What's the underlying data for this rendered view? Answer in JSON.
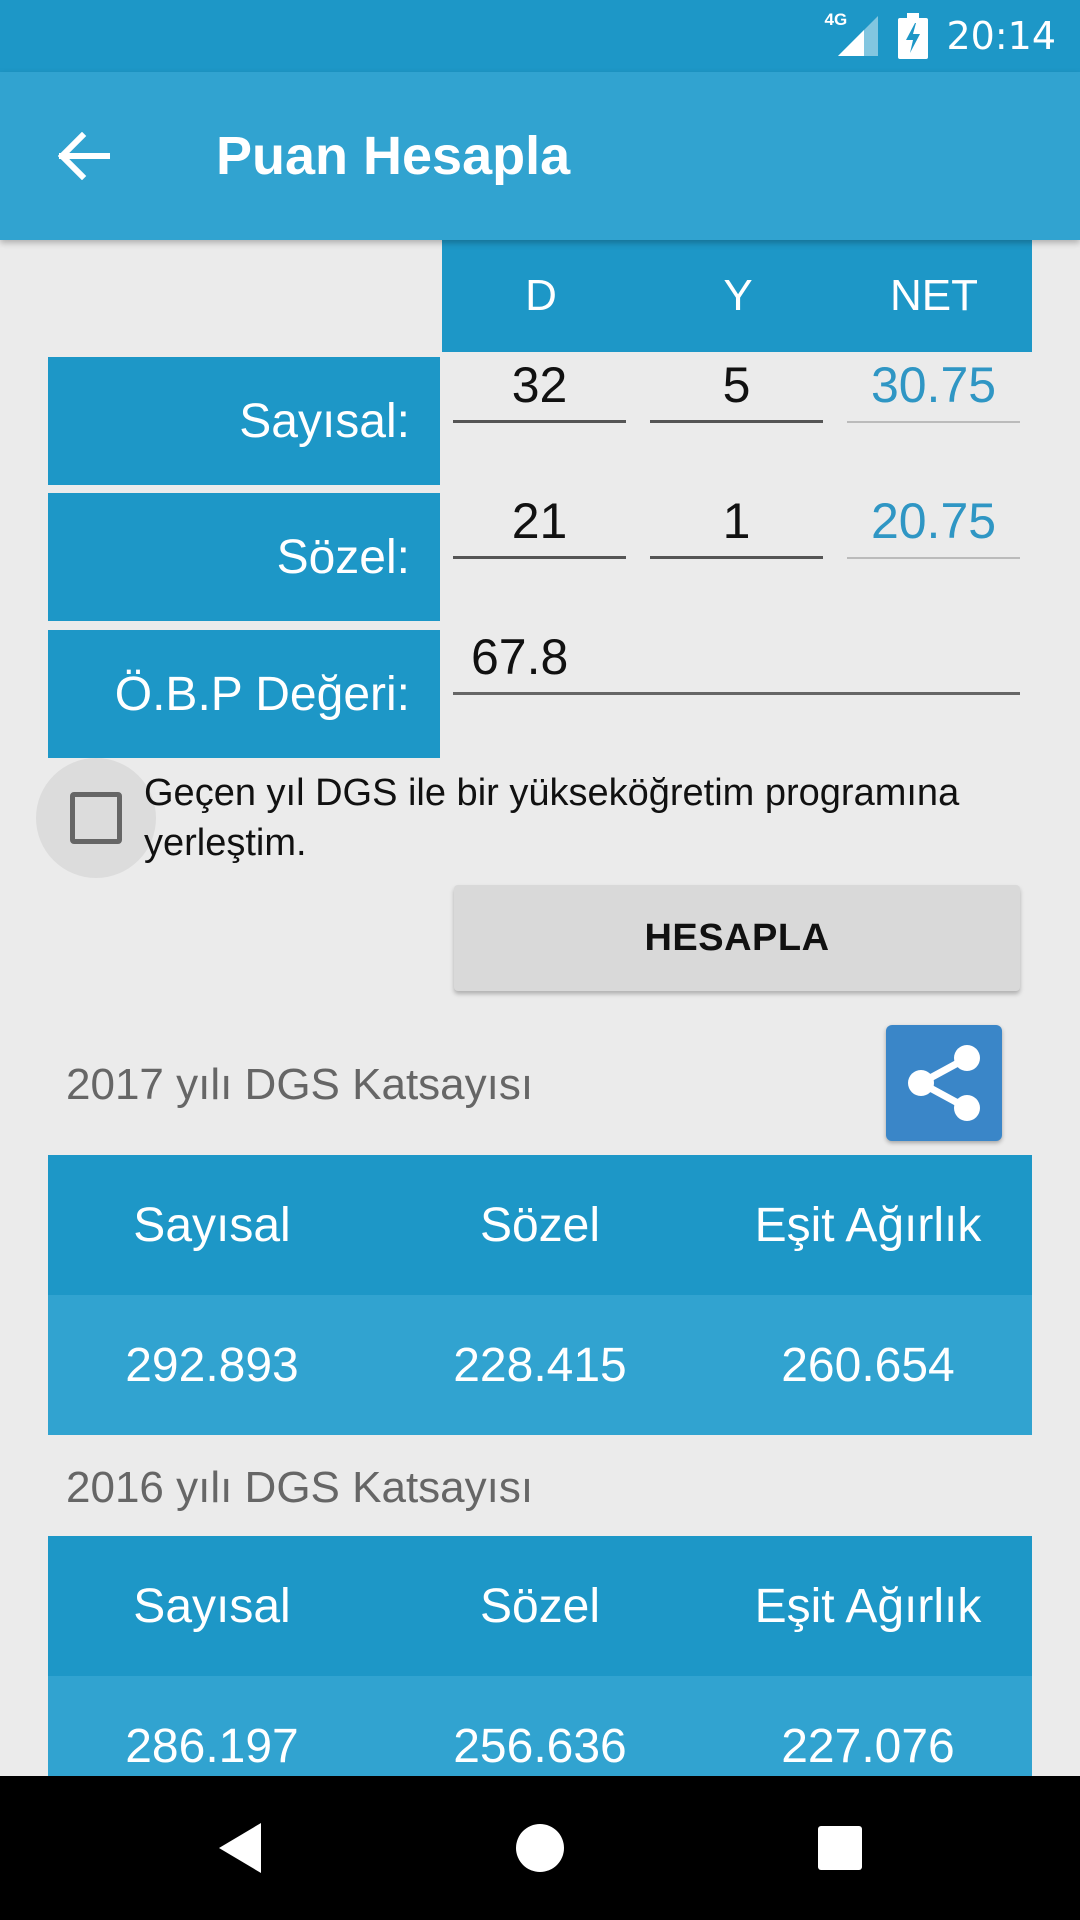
{
  "status": {
    "time": "20:14",
    "network": "4G"
  },
  "app_bar": {
    "title": "Puan Hesapla"
  },
  "columns": {
    "d": "D",
    "y": "Y",
    "net": "NET"
  },
  "rows": {
    "sayisal": {
      "label": "Sayısal:",
      "d": "32",
      "y": "5",
      "net": "30.75"
    },
    "sozel": {
      "label": "Sözel:",
      "d": "21",
      "y": "1",
      "net": "20.75"
    },
    "obp": {
      "label": "Ö.B.P Değeri:",
      "value": "67.8"
    }
  },
  "checkbox": {
    "label": "Geçen yıl DGS ile bir yükseköğretim programına yerleştim.",
    "checked": false
  },
  "calculate_button": "HESAPLA",
  "tables": [
    {
      "title": "2017 yılı DGS Katsayısı",
      "headers": [
        "Sayısal",
        "Sözel",
        "Eşit Ağırlık"
      ],
      "values": [
        "292.893",
        "228.415",
        "260.654"
      ]
    },
    {
      "title": "2016 yılı DGS Katsayısı",
      "headers": [
        "Sayısal",
        "Sözel",
        "Eşit Ağırlık"
      ],
      "values": [
        "286.197",
        "256.636",
        "227.076"
      ]
    }
  ],
  "colors": {
    "primary_dark": "#1d97c7",
    "primary": "#31a3d0",
    "net_text": "#2f96c4",
    "share": "#3a86c8"
  },
  "icons": {
    "back": "arrow-left-icon",
    "share": "share-icon",
    "nav_back": "triangle-back-icon",
    "nav_home": "circle-home-icon",
    "nav_recents": "square-recents-icon"
  }
}
